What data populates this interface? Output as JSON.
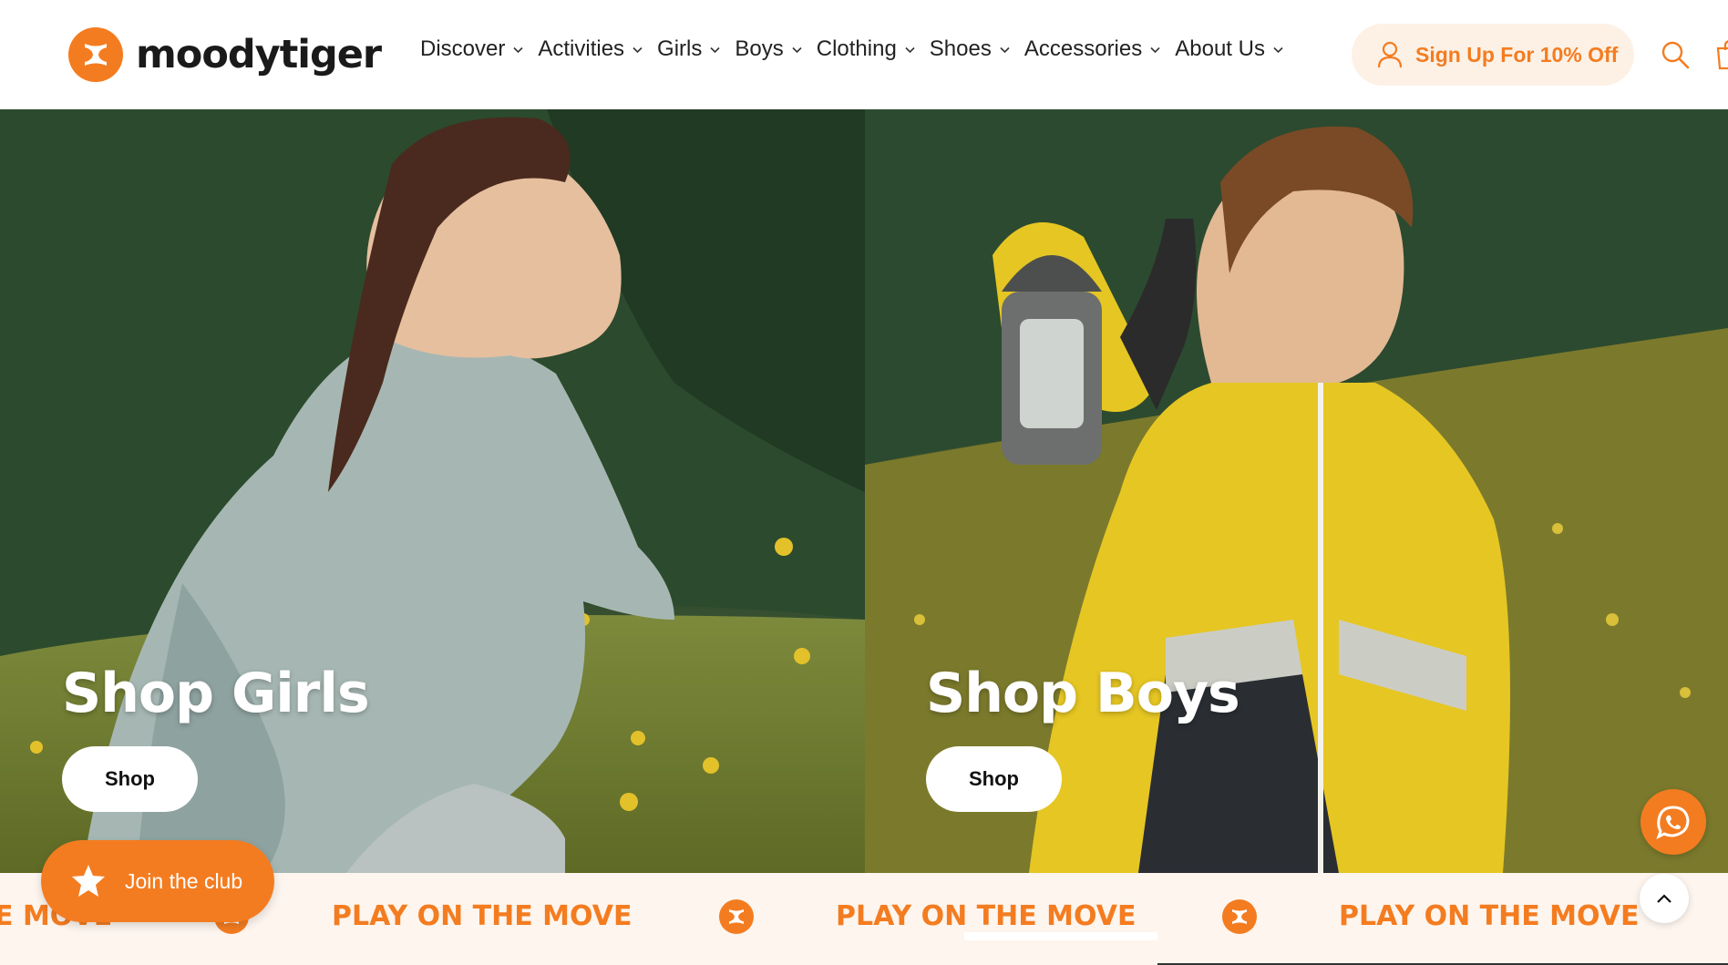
{
  "brand": {
    "name": "moodytiger",
    "logo_icon": "tiger-logo-icon",
    "accent_color": "#f47c20"
  },
  "nav": {
    "items": [
      {
        "label": "Discover"
      },
      {
        "label": "Activities"
      },
      {
        "label": "Girls"
      },
      {
        "label": "Boys"
      },
      {
        "label": "Clothing"
      },
      {
        "label": "Shoes"
      },
      {
        "label": "Accessories"
      },
      {
        "label": "About Us"
      }
    ],
    "signup_label": "Sign Up For 10% Off",
    "icons": [
      "user-icon",
      "search-icon",
      "cart-icon"
    ]
  },
  "hero": {
    "panels": [
      {
        "title": "Shop Girls",
        "button_label": "Shop"
      },
      {
        "title": "Shop Boys",
        "button_label": "Shop"
      }
    ]
  },
  "marquee": {
    "text": "PLAY ON THE MOVE",
    "partial_text": "E MOVE"
  },
  "floating": {
    "join_label": "Join the club",
    "join_icon": "star-icon",
    "chat_icon": "whatsapp-icon",
    "top_icon": "chevron-up-icon"
  }
}
